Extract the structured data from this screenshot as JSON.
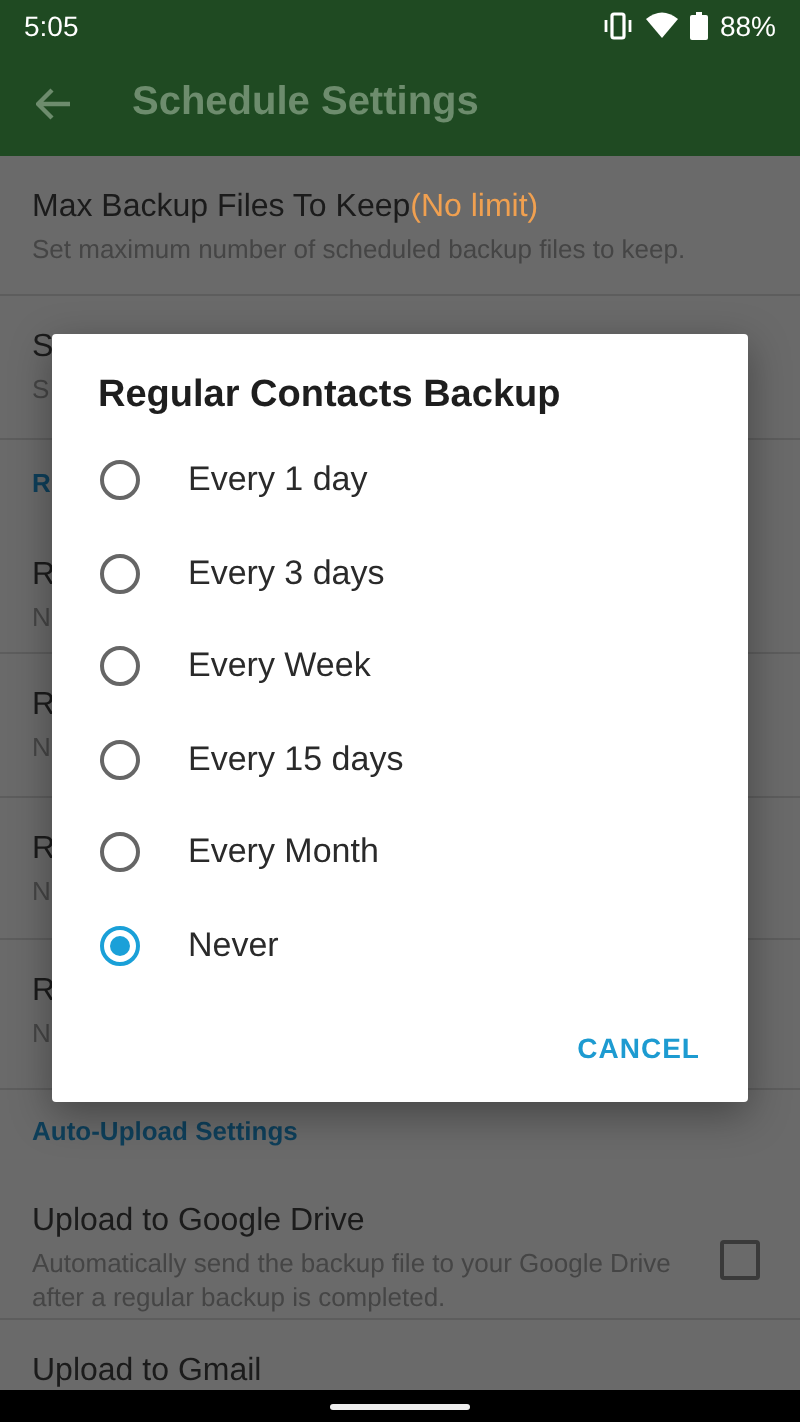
{
  "status_bar": {
    "time": "5:05",
    "battery": "88%"
  },
  "app_bar": {
    "title": "Schedule Settings"
  },
  "settings": [
    {
      "kind": "item",
      "title": "Max Backup Files To Keep",
      "value": "(No limit)",
      "subtitle": "Set maximum number of scheduled backup files to keep."
    },
    {
      "kind": "item",
      "title": "S",
      "subtitle": "S"
    },
    {
      "kind": "header",
      "title": "R"
    },
    {
      "kind": "item",
      "title": "R",
      "subtitle": "N"
    },
    {
      "kind": "item",
      "title": "R",
      "subtitle": "N"
    },
    {
      "kind": "item",
      "title": "R",
      "subtitle": "N"
    },
    {
      "kind": "item",
      "title": "R",
      "subtitle": "N"
    },
    {
      "kind": "header",
      "title": "Auto-Upload Settings"
    },
    {
      "kind": "checkbox",
      "title": "Upload to Google Drive",
      "subtitle": "Automatically send the backup file to your Google Drive after a regular backup is completed.",
      "checked": false
    },
    {
      "kind": "item",
      "title": "Upload to Gmail"
    }
  ],
  "dialog": {
    "title": "Regular Contacts Backup",
    "options": [
      {
        "label": "Every 1 day",
        "selected": false
      },
      {
        "label": "Every 3 days",
        "selected": false
      },
      {
        "label": "Every Week",
        "selected": false
      },
      {
        "label": "Every 15 days",
        "selected": false
      },
      {
        "label": "Every Month",
        "selected": false
      },
      {
        "label": "Never",
        "selected": true
      }
    ],
    "button": "CANCEL"
  }
}
